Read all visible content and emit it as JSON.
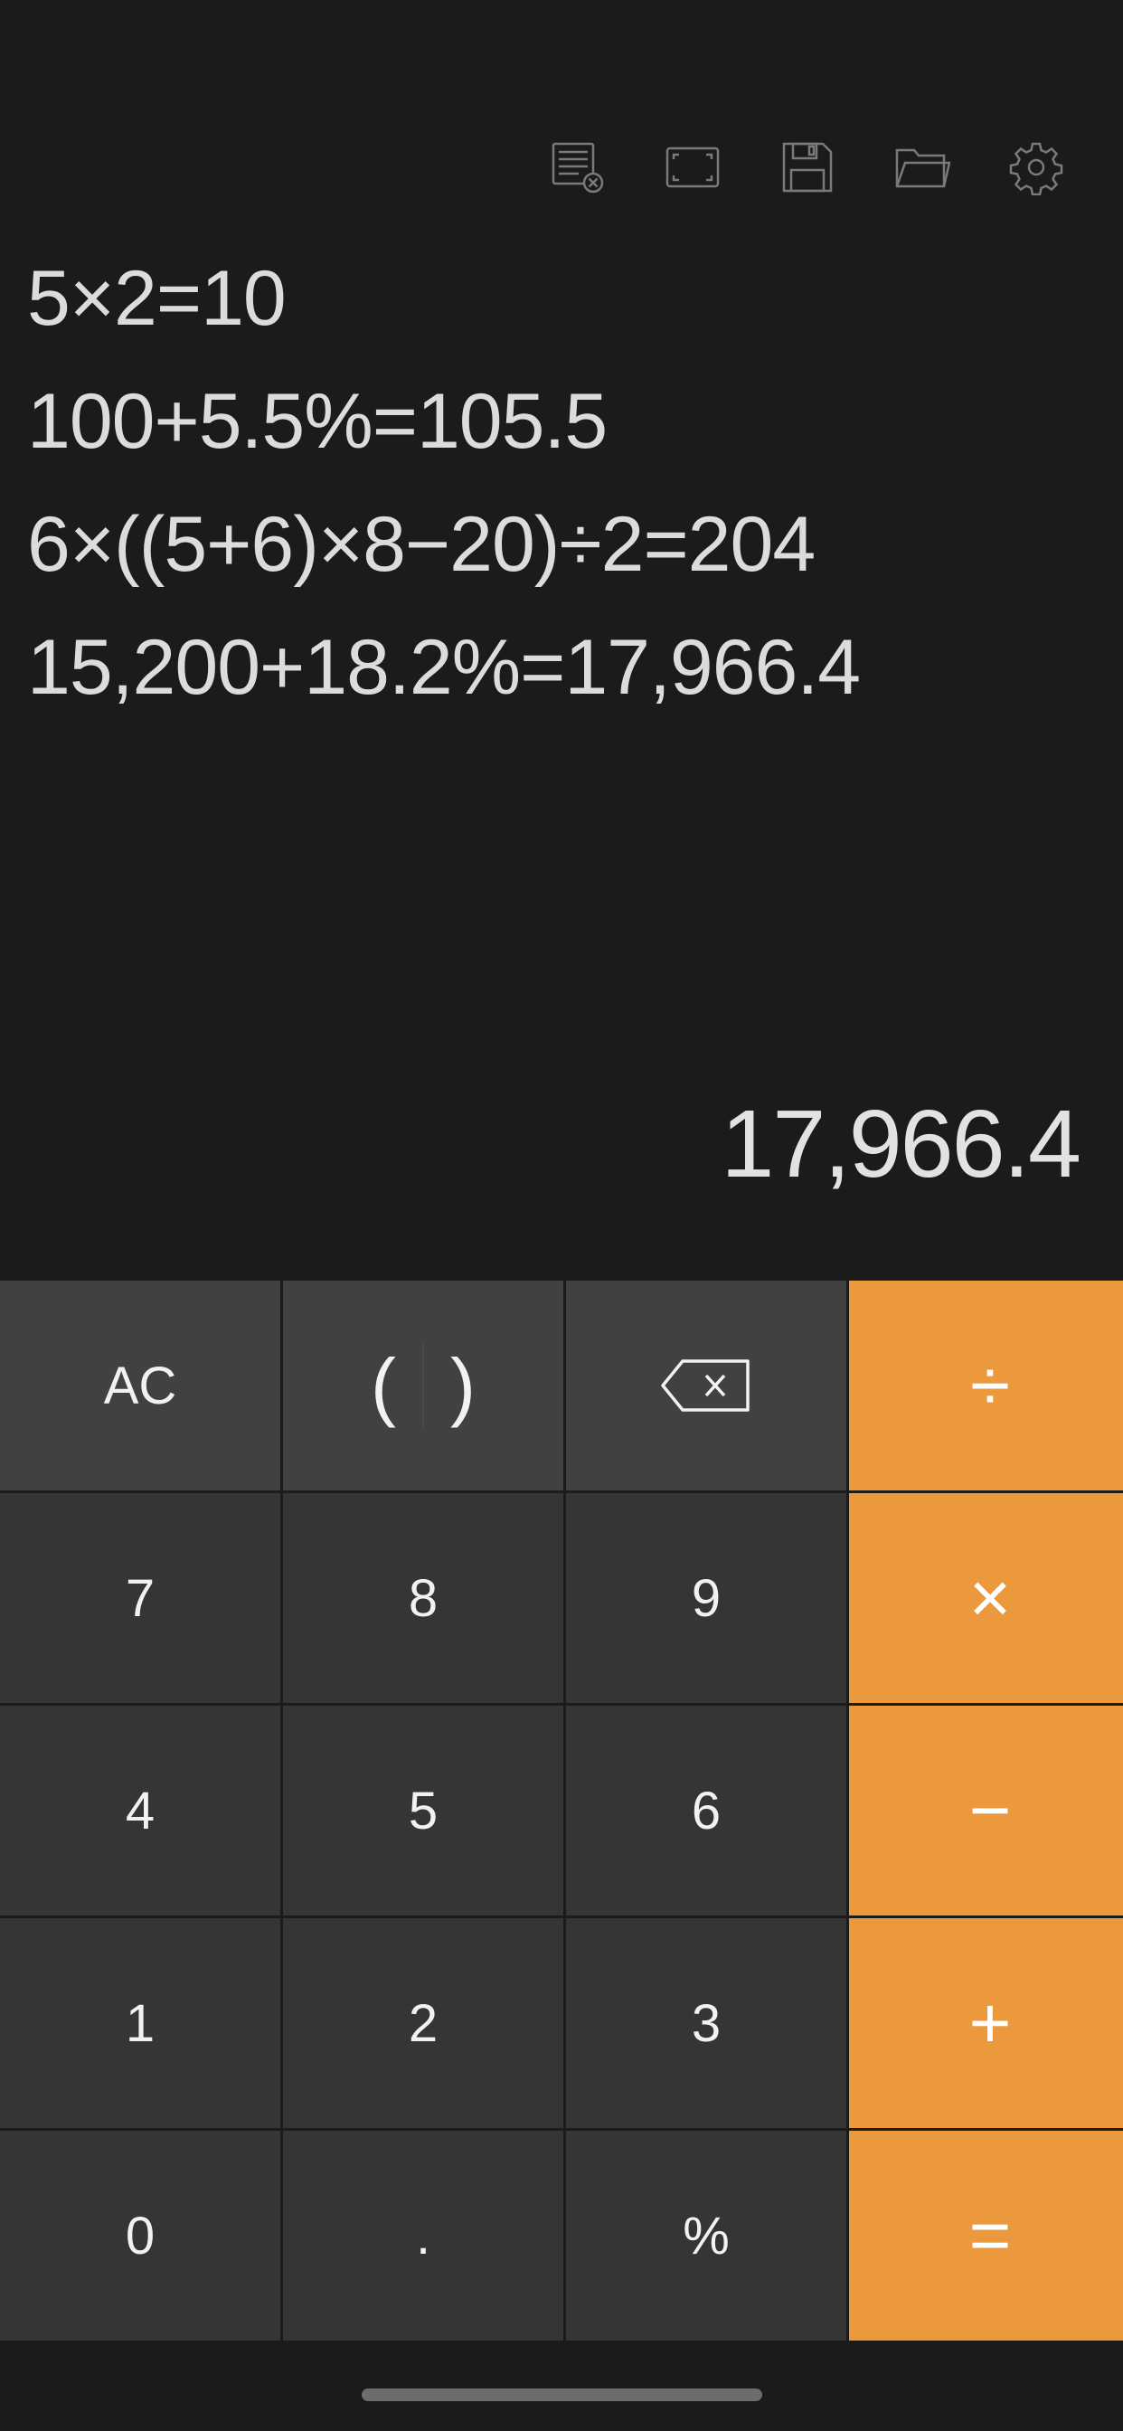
{
  "toolbar": {
    "icons": [
      "clear-history-icon",
      "fullscreen-icon",
      "save-icon",
      "folder-icon",
      "gear-icon"
    ]
  },
  "history": [
    "5×2=10",
    "100+5.5%=105.5",
    "6×((5+6)×8−20)÷2=204",
    "15,200+18.2%=17,966.4"
  ],
  "result": "17,966.4",
  "keys": {
    "ac": "AC",
    "paren_open": "(",
    "paren_close": ")",
    "divide": "÷",
    "seven": "7",
    "eight": "8",
    "nine": "9",
    "multiply": "×",
    "four": "4",
    "five": "5",
    "six": "6",
    "minus": "−",
    "one": "1",
    "two": "2",
    "three": "3",
    "plus": "+",
    "zero": "0",
    "decimal": ".",
    "percent": "%",
    "equals": "="
  },
  "colors": {
    "background": "#1b1b1b",
    "key_number": "#353535",
    "key_function": "#414141",
    "key_operator": "#eb993c",
    "text": "#f2f2f2"
  }
}
